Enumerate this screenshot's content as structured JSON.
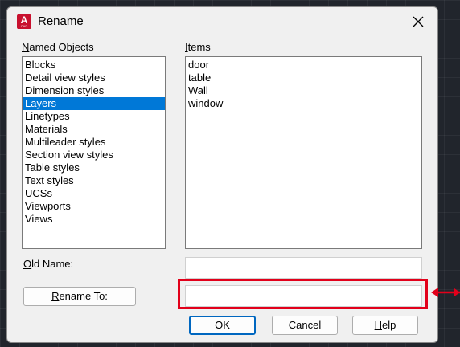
{
  "dialog": {
    "title": "Rename",
    "app_icon": {
      "letter": "A",
      "sub": "CAD"
    }
  },
  "named_objects": {
    "label_hotkey": "N",
    "label_rest": "amed Objects",
    "items": [
      "Blocks",
      "Detail view styles",
      "Dimension styles",
      "Layers",
      "Linetypes",
      "Materials",
      "Multileader styles",
      "Section view styles",
      "Table styles",
      "Text styles",
      "UCSs",
      "Viewports",
      "Views"
    ],
    "selected_index": 3
  },
  "items_list": {
    "label_hotkey": "I",
    "label_rest": "tems",
    "items": [
      "door",
      "table",
      "Wall",
      "window"
    ]
  },
  "old_name": {
    "label_hotkey": "O",
    "label_rest": "ld Name:",
    "value": ""
  },
  "rename_to": {
    "button_hotkey": "R",
    "button_rest": "ename To:",
    "value": ""
  },
  "buttons": {
    "ok": "OK",
    "cancel": "Cancel",
    "help_hotkey": "H",
    "help_rest": "elp"
  },
  "colors": {
    "selection": "#0078d7",
    "annotation_red": "#e2001a",
    "brand_red": "#c8102e"
  }
}
